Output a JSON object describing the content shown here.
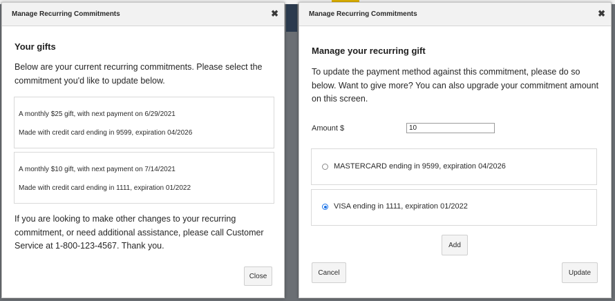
{
  "colors": {
    "accent": "#1a73e8",
    "backdrop": "#6b6f74"
  },
  "left_modal": {
    "title": "Manage Recurring Commitments",
    "close_glyph": "✖",
    "heading": "Your gifts",
    "intro": "Below are your current recurring commitments. Please select the commitment you'd like to update below.",
    "commitments": [
      {
        "line1": "A monthly $25 gift, with next payment on 6/29/2021",
        "line2": "Made with credit card ending in 9599, expiration 04/2026"
      },
      {
        "line1": "A monthly $10 gift, with next payment on 7/14/2021",
        "line2": "Made with credit card ending in 1111, expiration 01/2022"
      }
    ],
    "help_text": "If you are looking to make other changes to your recurring commitment, or need additional assistance, please call Customer Service at 1-800-123-4567. Thank you.",
    "close_label": "Close"
  },
  "right_modal": {
    "title": "Manage Recurring Commitments",
    "close_glyph": "✖",
    "heading": "Manage your recurring gift",
    "intro": "To update the payment method against this commitment, please do so below. Want to give more? You can also upgrade your commitment amount on this screen.",
    "amount_label": "Amount $",
    "amount_value": "10",
    "payment_methods": [
      {
        "label": "MASTERCARD ending in 9599, expiration 04/2026",
        "selected": false
      },
      {
        "label": "VISA ending in 1111, expiration 01/2022",
        "selected": true
      }
    ],
    "add_label": "Add",
    "cancel_label": "Cancel",
    "update_label": "Update"
  }
}
